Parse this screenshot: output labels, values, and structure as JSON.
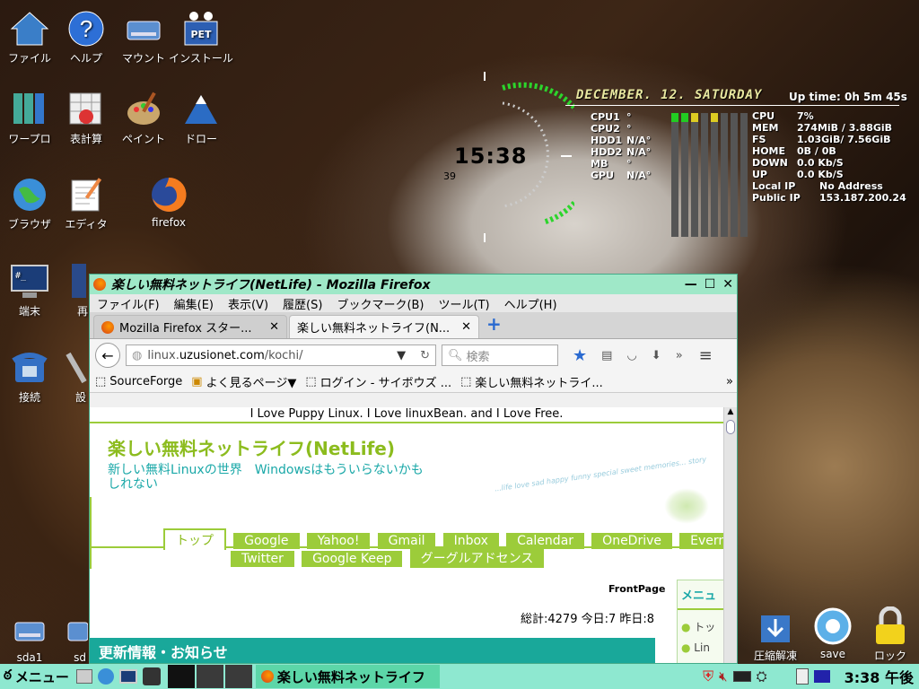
{
  "desktop": {
    "icons": [
      {
        "id": "file",
        "label": "ファイル"
      },
      {
        "id": "help",
        "label": "ヘルプ"
      },
      {
        "id": "mount",
        "label": "マウント"
      },
      {
        "id": "install",
        "label": "インストール"
      },
      {
        "id": "wp",
        "label": "ワープロ"
      },
      {
        "id": "sheet",
        "label": "表計算"
      },
      {
        "id": "paint",
        "label": "ペイント"
      },
      {
        "id": "draw",
        "label": "ドロー"
      },
      {
        "id": "browser",
        "label": "ブラウザ"
      },
      {
        "id": "editor",
        "label": "エディタ"
      },
      {
        "id": "firefox",
        "label": "firefox"
      },
      {
        "id": "term",
        "label": "端末"
      },
      {
        "id": "re",
        "label": "再"
      },
      {
        "id": "conn",
        "label": "接続"
      },
      {
        "id": "set",
        "label": "設"
      },
      {
        "id": "sda1",
        "label": "sda1"
      },
      {
        "id": "sd",
        "label": "sd"
      },
      {
        "id": "unzip",
        "label": "圧縮解凍"
      },
      {
        "id": "save",
        "label": "save"
      },
      {
        "id": "lock",
        "label": "ロック"
      }
    ],
    "pet_label": "PET"
  },
  "conky": {
    "date": "DECEMBER. 12. SATURDAY",
    "uptime": "Up time: 0h 5m 45s",
    "clock": "15:38",
    "clock_sub": "39",
    "left": [
      {
        "k": "CPU1",
        "v": "°"
      },
      {
        "k": "CPU2",
        "v": "°"
      },
      {
        "k": "HDD1",
        "v": "N/A°"
      },
      {
        "k": "HDD2",
        "v": "N/A°"
      },
      {
        "k": "MB",
        "v": "°"
      },
      {
        "k": "GPU",
        "v": "N/A°"
      }
    ],
    "right": [
      {
        "k": "CPU",
        "v": "7%"
      },
      {
        "k": "MEM",
        "v": "274MiB / 3.88GiB"
      },
      {
        "k": "FS",
        "v": "1.03GiB/ 7.56GiB"
      },
      {
        "k": "HOME",
        "v": "0B  / 0B"
      },
      {
        "k": "DOWN",
        "v": "0.0     Kb/S"
      },
      {
        "k": "UP",
        "v": "0.0     Kb/S"
      },
      {
        "k": "Local IP",
        "v": "No Address"
      },
      {
        "k": "Public IP",
        "v": "153.187.200.24"
      }
    ]
  },
  "firefox": {
    "title": "楽しい無料ネットライフ(NetLife) - Mozilla Firefox",
    "menu": [
      "ファイル(F)",
      "編集(E)",
      "表示(V)",
      "履歴(S)",
      "ブックマーク(B)",
      "ツール(T)",
      "ヘルプ(H)"
    ],
    "tabs": [
      "Mozilla Firefox スター...",
      "楽しい無料ネットライフ(N..."
    ],
    "url_prefix": "linux.",
    "url_domain": "uzusionet.com",
    "url_path": "/kochi/",
    "search_placeholder": "検索",
    "bookmarks": [
      "SourceForge",
      "よく見るページ▼",
      "ログイン - サイボウズ ...",
      "楽しい無料ネットライ..."
    ],
    "page": {
      "top_banner": "I Love Puppy Linux. I Love linuxBean. and I Love Free.",
      "site_title": "楽しい無料ネットライフ(NetLife)",
      "tagline": "新しい無料Linuxの世界　Windowsはもういらないかもしれない",
      "deco": "...life love sad happy funny special sweet memories... story",
      "nav1": [
        "トップ",
        "Google",
        "Yahoo!",
        "Gmail",
        "Inbox",
        "Calendar",
        "OneDrive",
        "Everno"
      ],
      "nav2": [
        "Twitter",
        "Google Keep",
        "グーグルアドセンス"
      ],
      "frontpage": "FrontPage",
      "counter": "総計:4279 今日:7 昨日:8",
      "update": "更新情報・お知らせ",
      "side_menu": "メニュ",
      "side_items": [
        "トッ",
        "Lin"
      ]
    }
  },
  "taskbar": {
    "menu": "メニュー",
    "window": "楽しい無料ネットライフ",
    "time": "3:38 午後"
  }
}
